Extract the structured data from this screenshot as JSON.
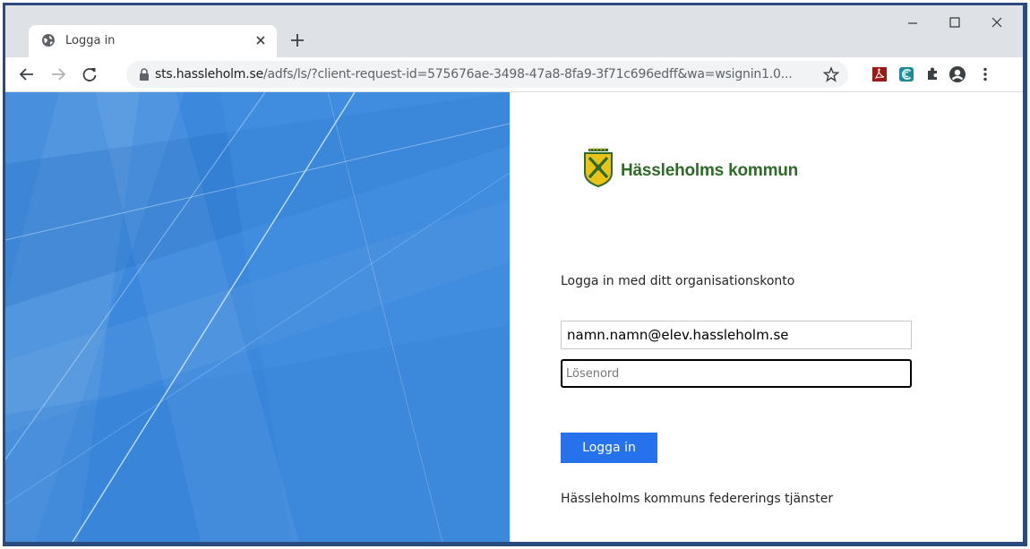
{
  "browser": {
    "tab": {
      "title": "Logga in"
    },
    "address_bar": {
      "host": "sts.hassleholm.se",
      "path": "/adfs/ls/?client-request-id=575676ae-3498-47a8-8fa9-3f71c696edff&wa=wsignin1.0..."
    },
    "window_controls": [
      "minimize",
      "maximize",
      "close"
    ],
    "extensions": [
      "pdf-extension-icon",
      "sync-extension-icon",
      "extensions-puzzle-icon",
      "profile-icon",
      "menu-icon"
    ]
  },
  "page": {
    "logo_text": "Hässleholms kommun",
    "heading": "Logga in med ditt organisationskonto",
    "email_value": "namn.namn@elev.hassleholm.se",
    "password_placeholder": "Lösenord",
    "submit_label": "Logga in",
    "footer": "Hässleholms kommuns federerings tjänster"
  },
  "colors": {
    "accent": "#2672ec",
    "background_blue": "#3b88dc",
    "logo_green": "#2e6b28",
    "logo_yellow": "#e9c31a"
  }
}
